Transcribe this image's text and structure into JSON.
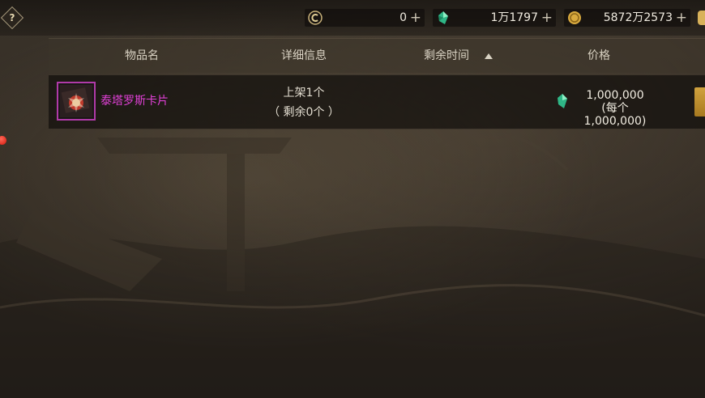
{
  "topbar": {
    "help_label": "?",
    "currencies": [
      {
        "name": "coin-c",
        "value": "0",
        "plus": "+"
      },
      {
        "name": "gem",
        "value": "1万1797",
        "plus": "+"
      },
      {
        "name": "gold",
        "value": "5872万2573",
        "plus": "+"
      }
    ]
  },
  "table": {
    "headers": {
      "item_name": "物品名",
      "details": "详细信息",
      "time_left": "剩余时间",
      "price": "价格"
    }
  },
  "listing": {
    "name": "泰塔罗斯卡片",
    "listed": "上架1个",
    "remaining": "（ 剩余0个 ）",
    "price": "1,000,000",
    "price_each": "(每个1,000,000)"
  },
  "colors": {
    "item_name": "#e040d6",
    "item_border": "#b03aa8",
    "gem": "#3fcf9a",
    "gold": "#e0b24a"
  }
}
